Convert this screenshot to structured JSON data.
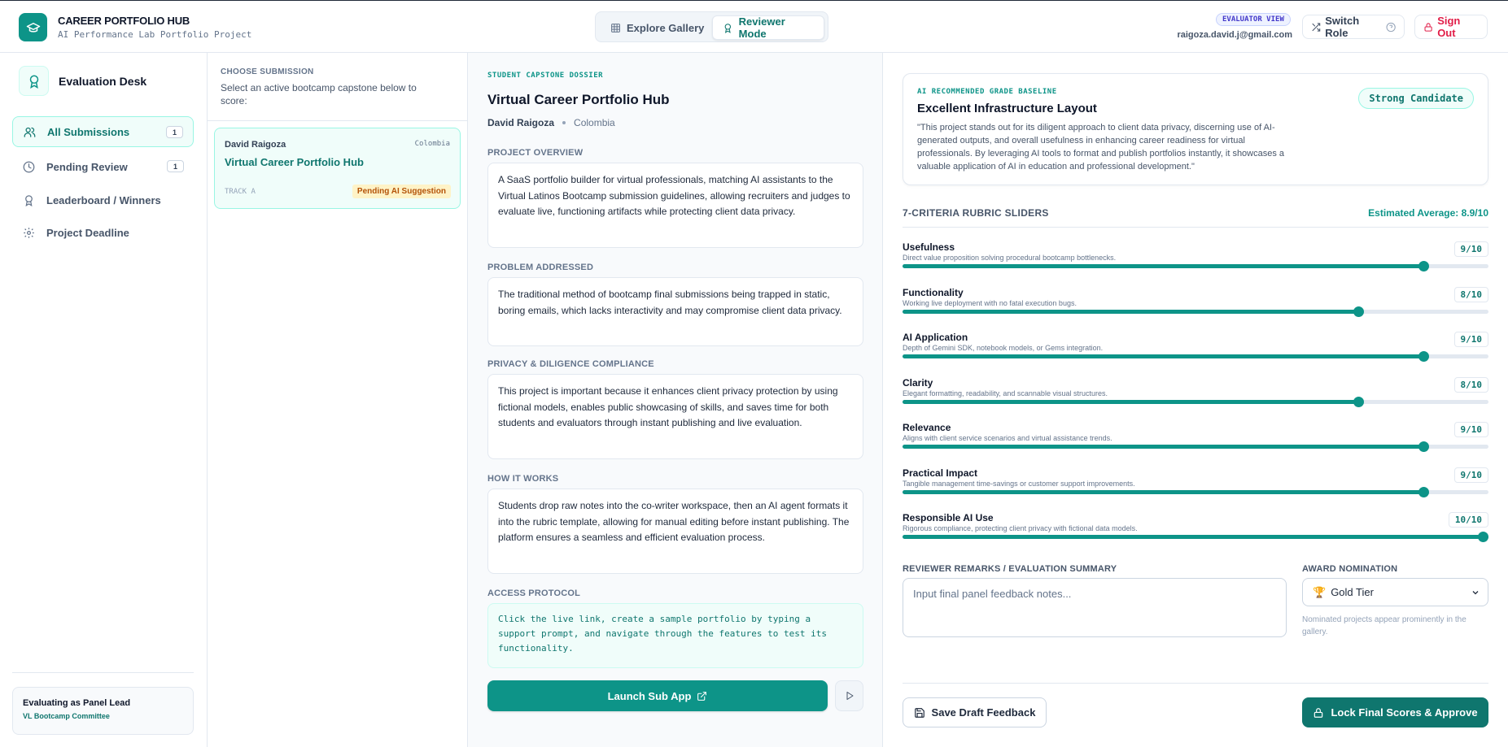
{
  "header": {
    "brand_title": "CAREER PORTFOLIO HUB",
    "brand_subtitle": "AI Performance Lab Portfolio Project",
    "modes": {
      "explore": "Explore Gallery",
      "reviewer": "Reviewer Mode",
      "active": "reviewer"
    },
    "evaluator_badge": "EVALUATOR VIEW",
    "user_email": "raigoza.david.j@gmail.com",
    "switch_role": "Switch Role",
    "sign_out": "Sign Out"
  },
  "sidebar": {
    "title": "Evaluation Desk",
    "items": [
      {
        "label": "All Submissions",
        "count": "1",
        "icon": "users-icon",
        "active": true
      },
      {
        "label": "Pending Review",
        "count": "1",
        "icon": "clock-icon",
        "active": false
      },
      {
        "label": "Leaderboard / Winners",
        "count": "",
        "icon": "award-icon",
        "active": false
      },
      {
        "label": "Project Deadline",
        "count": "",
        "icon": "gear-icon",
        "active": false
      }
    ],
    "panel_lead": {
      "title": "Evaluating as Panel Lead",
      "committee": "VL Bootcamp Committee"
    }
  },
  "submissions": {
    "label": "CHOOSE SUBMISSION",
    "subtitle": "Select an active bootcamp capstone below to score:",
    "items": [
      {
        "author": "David Raigoza",
        "country": "Colombia",
        "title": "Virtual Career Portfolio Hub",
        "track": "TRACK A",
        "status": "Pending AI Suggestion"
      }
    ]
  },
  "dossier": {
    "label": "STUDENT CAPSTONE DOSSIER",
    "title": "Virtual Career Portfolio Hub",
    "author": "David Raigoza",
    "country": "Colombia",
    "sections": {
      "overview": {
        "label": "PROJECT OVERVIEW",
        "text": "A SaaS portfolio builder for virtual professionals, matching AI assistants to the Virtual Latinos Bootcamp submission guidelines, allowing recruiters and judges to evaluate live, functioning artifacts while protecting client data privacy."
      },
      "problem": {
        "label": "PROBLEM ADDRESSED",
        "text": "The traditional method of bootcamp final submissions being trapped in static, boring emails, which lacks interactivity and may compromise client data privacy."
      },
      "privacy": {
        "label": "PRIVACY & DILIGENCE COMPLIANCE",
        "text": "This project is important because it enhances client privacy protection by using fictional models, enables public showcasing of skills, and saves time for both students and evaluators through instant publishing and live evaluation."
      },
      "how": {
        "label": "HOW IT WORKS",
        "text": "Students drop raw notes into the co-writer workspace, then an AI agent formats it into the rubric template, allowing for manual editing before instant publishing. The platform ensures a seamless and efficient evaluation process."
      },
      "access": {
        "label": "ACCESS PROTOCOL",
        "text": "Click the live link, create a sample portfolio by typing a support prompt, and navigate through the features to test its functionality."
      }
    },
    "launch_label": "Launch Sub App"
  },
  "grading": {
    "ai": {
      "label": "AI RECOMMENDED GRADE BASELINE",
      "title": "Excellent Infrastructure Layout",
      "text": "\"This project stands out for its diligent approach to client data privacy, discerning use of AI-generated outputs, and overall usefulness in enhancing career readiness for virtual professionals. By leveraging AI tools to format and publish portfolios instantly, it showcases a valuable application of AI in education and professional development.\"",
      "badge": "Strong Candidate"
    },
    "rubric_title": "7-CRITERIA RUBRIC SLIDERS",
    "average": "Estimated Average: 8.9/10",
    "criteria": [
      {
        "name": "Usefulness",
        "desc": "Direct value proposition solving procedural bootcamp bottlenecks.",
        "score": "9/10",
        "value": 9
      },
      {
        "name": "Functionality",
        "desc": "Working live deployment with no fatal execution bugs.",
        "score": "8/10",
        "value": 8
      },
      {
        "name": "AI Application",
        "desc": "Depth of Gemini SDK, notebook models, or Gems integration.",
        "score": "9/10",
        "value": 9
      },
      {
        "name": "Clarity",
        "desc": "Elegant formatting, readability, and scannable visual structures.",
        "score": "8/10",
        "value": 8
      },
      {
        "name": "Relevance",
        "desc": "Aligns with client service scenarios and virtual assistance trends.",
        "score": "9/10",
        "value": 9
      },
      {
        "name": "Practical Impact",
        "desc": "Tangible management time-savings or customer support improvements.",
        "score": "9/10",
        "value": 9
      },
      {
        "name": "Responsible AI Use",
        "desc": "Rigorous compliance, protecting client privacy with fictional data models.",
        "score": "10/10",
        "value": 10
      }
    ],
    "remarks_label": "REVIEWER REMARKS / EVALUATION SUMMARY",
    "remarks_placeholder": "Input final panel feedback notes...",
    "award_label": "AWARD NOMINATION",
    "award_selected": "Gold Tier",
    "award_emoji": "🏆",
    "award_note": "Nominated projects appear prominently in the gallery.",
    "save_draft": "Save Draft Feedback",
    "lock_final": "Lock Final Scores & Approve"
  },
  "colors": {
    "accent": "#0d9488",
    "accent_dark": "#0f766e",
    "danger": "#e11d48",
    "pending_bg": "#fef3c7"
  }
}
